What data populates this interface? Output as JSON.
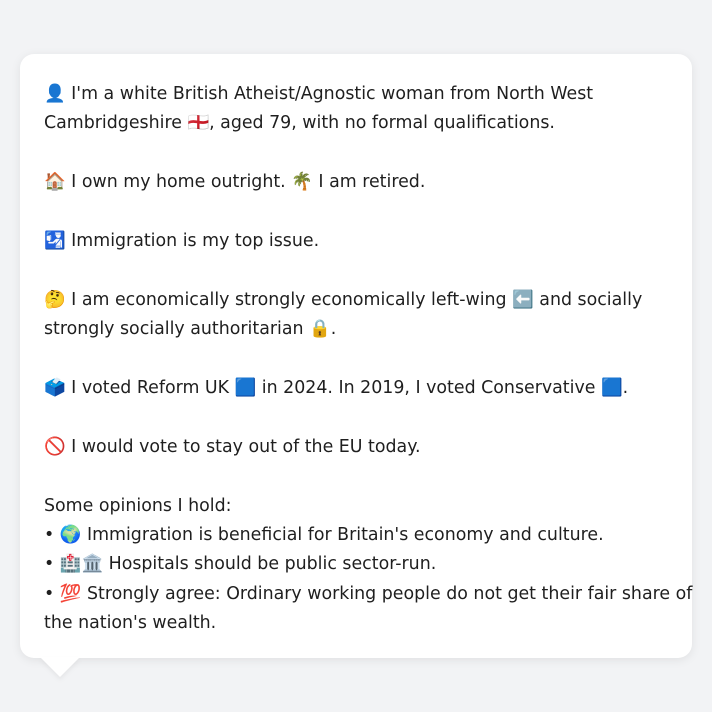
{
  "profile": {
    "identity_line1": "👤 I'm a white British Atheist/Agnostic woman from North West",
    "identity_line2": "Cambridgeshire 🏴󠁧󠁢󠁥󠁮󠁧󠁿, aged 79, with no formal qualifications.",
    "home_work": "🏠 I own my home outright. 🌴 I am retired.",
    "top_issue": "🛂 Immigration is my top issue.",
    "ideology_line1": "🤔 I am economically strongly economically left-wing ⬅️ and socially",
    "ideology_line2": "strongly socially authoritarian 🔒.",
    "vote_history": "🗳️ I voted Reform UK 🟦 in 2024. In 2019, I voted Conservative 🟦.",
    "eu_stance": "🚫 I would vote to stay out of the EU today."
  },
  "opinions": {
    "heading": "Some opinions I hold:",
    "items": [
      {
        "line1": "• 🌍 Immigration is beneficial for Britain's economy and culture.",
        "line2": ""
      },
      {
        "line1": "• 🏥🏛️ Hospitals should be public sector-run.",
        "line2": ""
      },
      {
        "line1": "• 💯 Strongly agree: Ordinary working people do not get their fair share of",
        "line2": "the nation's wealth."
      }
    ]
  },
  "colors": {
    "background": "#f2f3f5",
    "bubble": "#ffffff",
    "text": "#1f1f1f"
  }
}
